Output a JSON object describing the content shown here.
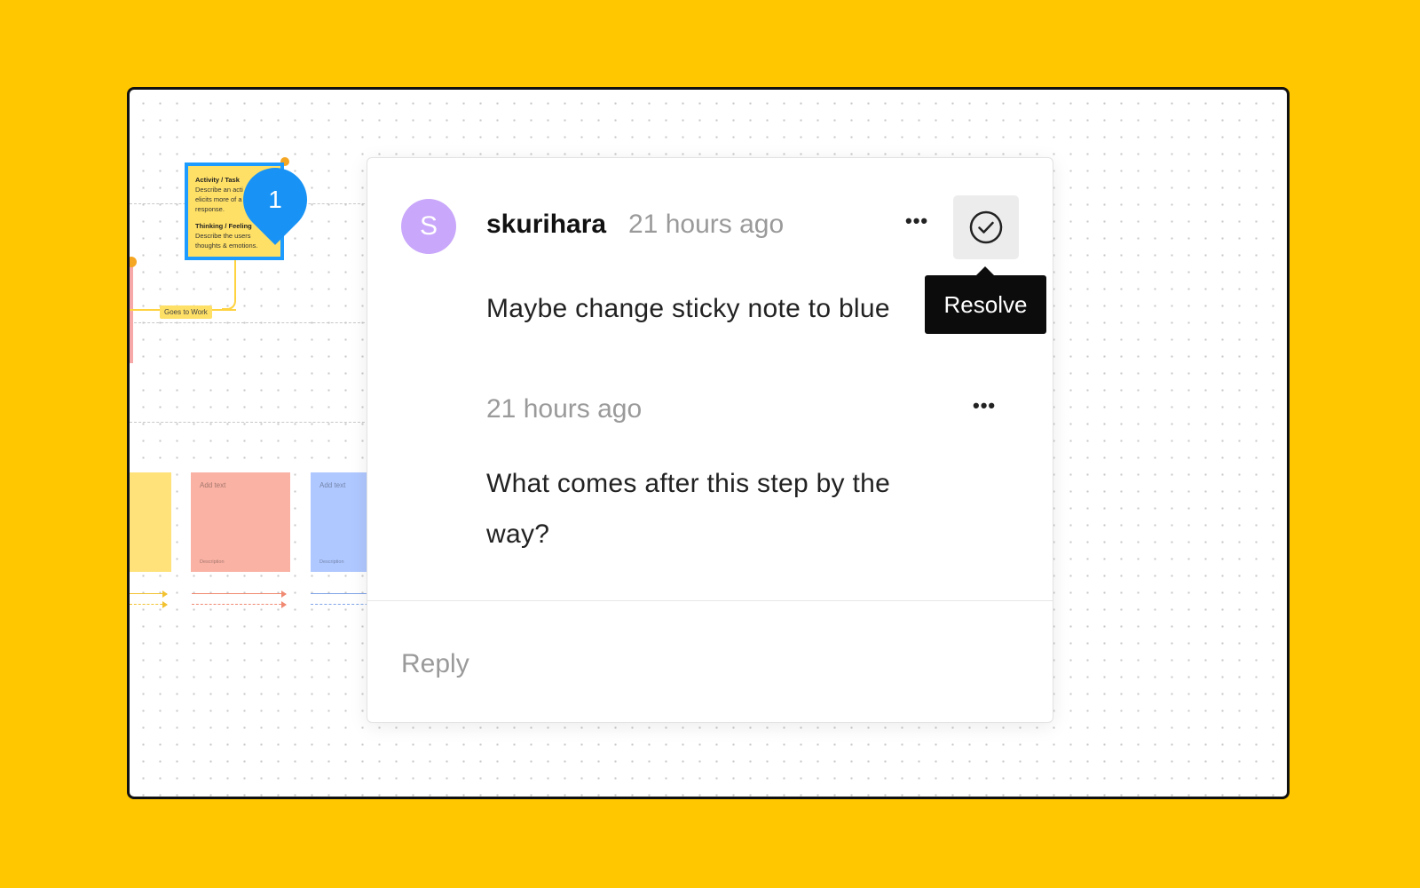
{
  "canvas": {
    "sticky_main": {
      "heading1": "Activity / Task",
      "line1": "Describe an acti",
      "line2": "elicits more of a",
      "line3": "response.",
      "heading2": "Thinking / Feeling",
      "line4": "Describe the users",
      "line5": "thoughts & emotions."
    },
    "pin_number": "1",
    "connector_label": "Goes to Work",
    "notes": [
      {
        "label": "Add text",
        "foot": "Description"
      },
      {
        "label": "Add text",
        "foot": "Description"
      }
    ],
    "colors": {
      "background": "#FFC700",
      "selection": "#1E9BFF",
      "pin": "#1893F5"
    }
  },
  "comment_thread": {
    "author": "skurihara",
    "avatar_initial": "S",
    "avatar_color": "#C9A7FA",
    "comments": [
      {
        "time": "21 hours ago",
        "text": "Maybe change sticky note to blue"
      },
      {
        "time": "21 hours ago",
        "text_line1": "What comes after this step by the",
        "text_line2": "way?"
      }
    ],
    "more_icon": "•••",
    "resolve_tooltip": "Resolve",
    "reply_placeholder": "Reply"
  }
}
